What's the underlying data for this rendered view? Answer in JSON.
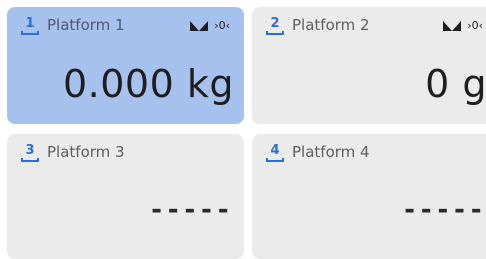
{
  "accent_color": "#2a6fd6",
  "active_tile_color": "#a6c1ee",
  "tile_color": "#ebebeb",
  "platforms": [
    {
      "number": "1",
      "label": "Platform 1",
      "value": "0.000 kg",
      "active": true,
      "icons": [
        "stability-icon",
        "zero-icon"
      ],
      "zero_glyph": "›0‹"
    },
    {
      "number": "2",
      "label": "Platform 2",
      "value": "0 g",
      "active": false,
      "icons": [
        "stability-icon",
        "zero-icon"
      ],
      "zero_glyph": "›0‹"
    },
    {
      "number": "3",
      "label": "Platform 3",
      "value": "-----",
      "active": false
    },
    {
      "number": "4",
      "label": "Platform 4",
      "value": "-----",
      "active": false
    }
  ]
}
